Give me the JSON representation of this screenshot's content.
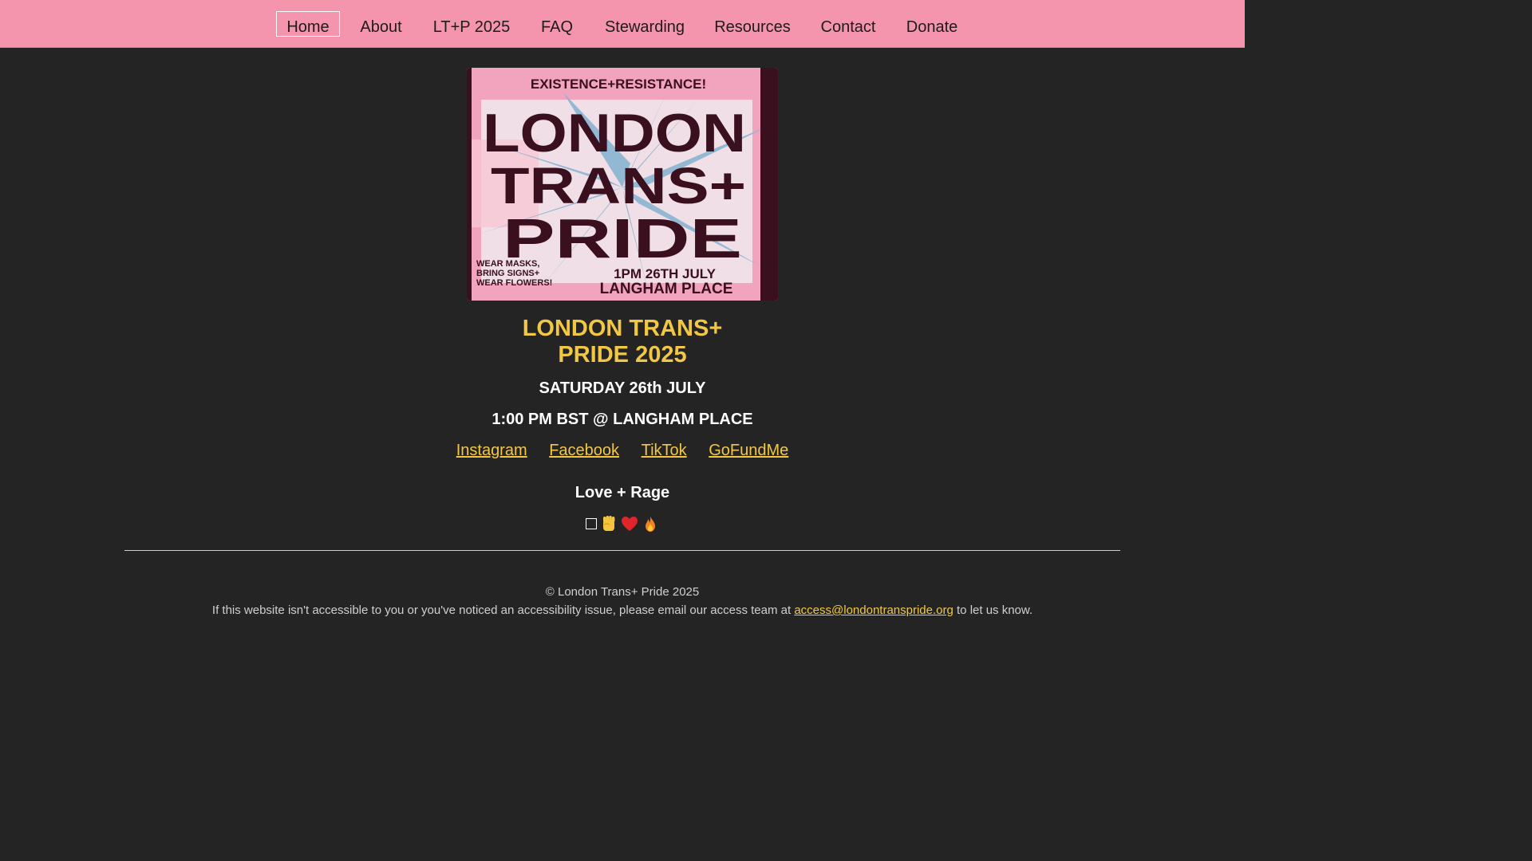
{
  "nav": {
    "items": [
      {
        "label": "Home",
        "active": true
      },
      {
        "label": "About"
      },
      {
        "label": "LT+P 2025"
      },
      {
        "label": "FAQ"
      },
      {
        "label": "Stewarding"
      },
      {
        "label": "Resources"
      },
      {
        "label": "Contact"
      },
      {
        "label": "Donate"
      }
    ]
  },
  "poster": {
    "top_text": "EXISTENCE+RESISTANCE!",
    "line1": "LONDON",
    "line2": "TRANS+",
    "line3": "PRIDE",
    "bottom_left": "WEAR MASKS, BRING SIGNS+ WEAR FLOWERS!",
    "bottom_right_1": "1PM 26TH JULY",
    "bottom_right_2": "LANGHAM PLACE"
  },
  "hero": {
    "title_line1": "LONDON TRANS+",
    "title_line2": "PRIDE 2025",
    "date": "SATURDAY 26th JULY",
    "time_place": "1:00 PM BST @ LANGHAM PLACE"
  },
  "social": {
    "instagram": "Instagram",
    "facebook": "Facebook",
    "tiktok": "TikTok",
    "gofundme": "GoFundMe"
  },
  "tagline": "Love + Rage",
  "emoji": {
    "icons": [
      "trans-flag-icon",
      "raised-fist-icon",
      "red-heart-icon",
      "fire-icon"
    ]
  },
  "footer": {
    "copyright": "© London Trans+ Pride 2025",
    "access_before": "If this website isn't accessible to you or you've noticed an accessibility issue, please email our access team at ",
    "access_email": "access@londontranspride.org",
    "access_after": " to let us know."
  },
  "colors": {
    "nav_bg": "#f595ad",
    "page_bg": "#242424",
    "accent_yellow": "#f2c744",
    "poster_pink": "#f2a3be",
    "poster_blue": "#8fb6d2",
    "poster_ink": "#3a0f1e"
  }
}
